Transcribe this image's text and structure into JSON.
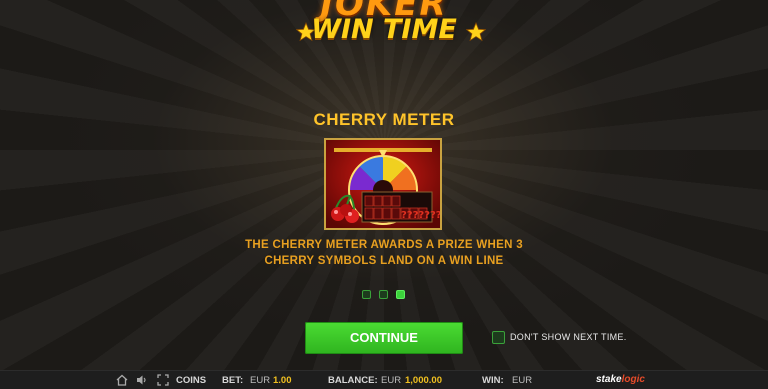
{
  "game": {
    "logo_top": "JOKER",
    "logo_sub": "WIN TIME"
  },
  "page": {
    "title": "CHERRY METER",
    "desc_line1": "THE CHERRY METER AWARDS A PRIZE WHEN 3",
    "desc_line2": "CHERRY SYMBOLS LAND ON A WIN LINE",
    "page_index": 3,
    "page_count": 3
  },
  "thumbnail": {
    "meter_slots": "???????"
  },
  "actions": {
    "continue_label": "CONTINUE",
    "dont_show_label": "DON'T SHOW NEXT TIME.",
    "dont_show_checked": false
  },
  "status_bar": {
    "coins_label": "COINS",
    "bet_label": "BET:",
    "bet_currency": "EUR",
    "bet_value": "1.00",
    "balance_label": "BALANCE:",
    "balance_currency": "EUR",
    "balance_value": "1,000.00",
    "win_label": "WIN:",
    "win_currency": "EUR",
    "brand_a": "stake",
    "brand_b": "logic"
  },
  "colors": {
    "accent_green": "#3cd23c",
    "title_gold": "#ffc42a",
    "desc_orange": "#e8a020"
  },
  "icons": [
    "star-icon",
    "home-icon",
    "sound-icon",
    "fullscreen-icon",
    "cherry-icon"
  ]
}
